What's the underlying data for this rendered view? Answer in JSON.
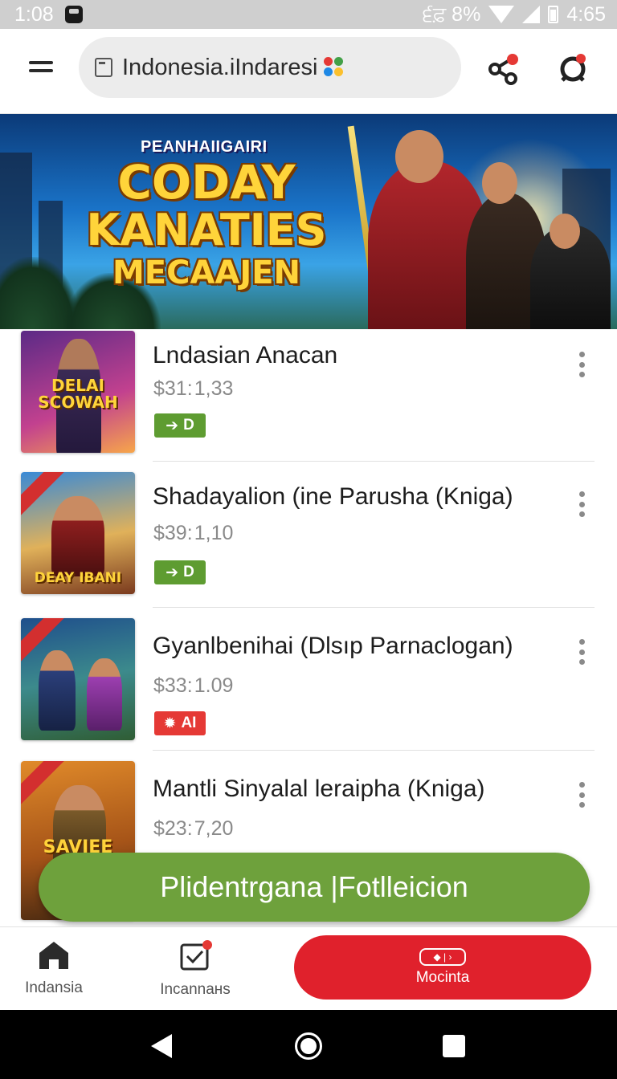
{
  "status_bar": {
    "time": "1:08",
    "right_text": "੬ਫ਼ 8%",
    "clock": "4:65"
  },
  "header": {
    "search_text": "Indonesia.iIndaresi",
    "icons": [
      "menu-icon",
      "page-icon",
      "share-icon",
      "profile-icon"
    ]
  },
  "banner": {
    "kicker": "PEANHAIIGAIRI",
    "title_line1": "CODAY",
    "title_line2": "KANATIES",
    "title_line3": "MECAAJEN"
  },
  "items": [
    {
      "title": "Lndasian Anacan",
      "price": "$31: 1,33",
      "thumb_text": "DELAI\nSCOWAH",
      "badge_text": "D",
      "badge_color": "#5e9c31"
    },
    {
      "title": "Shadayalion (ine Parusha (Kniga)",
      "price": "$39: 1,10",
      "thumb_text": "DEAY IBANI",
      "badge_text": "D",
      "badge_color": "#5e9c31"
    },
    {
      "title": "Gyanlbenihai  (Dlsıp Parnaclogan)",
      "price": "$33: 1.09",
      "thumb_text": "",
      "badge_text": "AI",
      "badge_color": "#e53935"
    },
    {
      "title": "Mantli Sinyalal leraipha (Kniga)",
      "price": "$23: 7,20",
      "thumb_text": "SAVIEE",
      "badge_text": "",
      "badge_color": "#5e9c31"
    }
  ],
  "cta": {
    "label": "Plidentrgana |Fotlleicion",
    "color": "#6ea13c"
  },
  "bottom_nav": {
    "home_label": "Indansia",
    "inbox_label": "Incannaнs",
    "action_label": "Mocinta",
    "action_color": "#e0212c"
  }
}
